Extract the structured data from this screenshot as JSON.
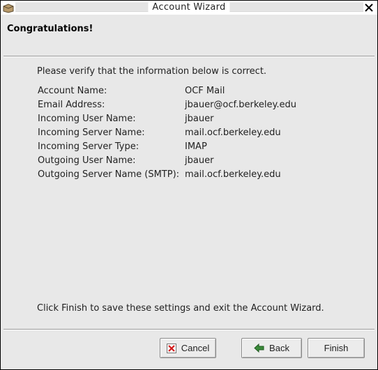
{
  "window": {
    "title": "Account Wizard"
  },
  "header": {
    "title": "Congratulations!"
  },
  "content": {
    "intro": "Please verify that the information below is correct.",
    "rows": [
      {
        "label": "Account Name:",
        "value": "OCF Mail"
      },
      {
        "label": "Email Address:",
        "value": "jbauer@ocf.berkeley.edu"
      },
      {
        "label": "Incoming User Name:",
        "value": "jbauer"
      },
      {
        "label": "Incoming Server Name:",
        "value": "mail.ocf.berkeley.edu"
      },
      {
        "label": "Incoming Server Type:",
        "value": "IMAP"
      },
      {
        "label": "Outgoing User Name:",
        "value": "jbauer"
      },
      {
        "label": "Outgoing Server Name (SMTP):",
        "value": "mail.ocf.berkeley.edu"
      }
    ],
    "footer": "Click Finish to save these settings and exit the Account Wizard."
  },
  "buttons": {
    "cancel": {
      "label": "Cancel",
      "icon": "cancel-x-icon"
    },
    "back": {
      "label": "Back",
      "icon": "back-arrow-icon"
    },
    "finish": {
      "label": "Finish"
    }
  },
  "colors": {
    "window_bg": "#e8e8e8",
    "titlebar_bg": "#ffffff",
    "cancel_icon": "#d11919",
    "back_icon": "#2e7d32"
  }
}
